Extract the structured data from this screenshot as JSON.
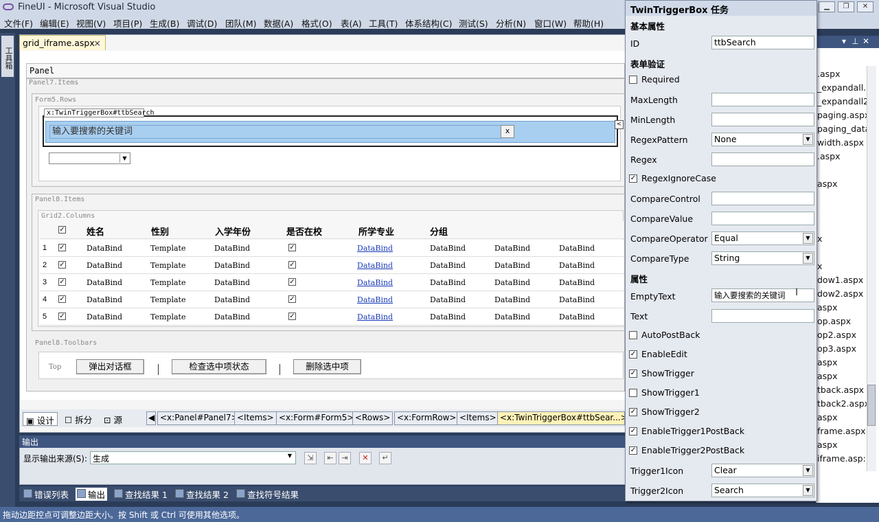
{
  "window": {
    "title": "FineUI - Microsoft Visual Studio"
  },
  "menu": [
    "文件(F)",
    "编辑(E)",
    "视图(V)",
    "项目(P)",
    "生成(B)",
    "调试(D)",
    "团队(M)",
    "数据(A)",
    "格式(O)",
    "表(A)",
    "工具(T)",
    "体系结构(C)",
    "测试(S)",
    "分析(N)",
    "窗口(W)",
    "帮助(H)"
  ],
  "toolbox_tab": "工具箱",
  "doc_tab": {
    "label": "grid_iframe.aspx",
    "close": "×"
  },
  "design": {
    "panel_title": "Panel",
    "panel7_items": "Panel7.Items",
    "form5_rows": "Form5.Rows",
    "ttb_tag": "x:TwinTriggerBox#ttbSearch",
    "ttb_empty_text": "输入要搜索的关键词",
    "ttb_clear": "x",
    "smart_tag": "<",
    "panel8_items": "Panel8.Items",
    "grid2_columns": "Grid2.Columns",
    "panel8_toolbars": "Panel8.Toolbars",
    "toolbar_pos": "Top",
    "buttons": [
      "弹出对话框",
      "检查选中项状态",
      "删除选中项"
    ]
  },
  "grid": {
    "headers": [
      "姓名",
      "性别",
      "入学年份",
      "是否在校",
      "所学专业",
      "分组"
    ],
    "rows": [
      {
        "n": "1",
        "c1": "DataBind",
        "c2": "Template",
        "c3": "DataBind",
        "c5": "DataBind",
        "c6": "DataBind",
        "c7": "DataBind",
        "c8": "DataBind"
      },
      {
        "n": "2",
        "c1": "DataBind",
        "c2": "Template",
        "c3": "DataBind",
        "c5": "DataBind",
        "c6": "DataBind",
        "c7": "DataBind",
        "c8": "DataBind"
      },
      {
        "n": "3",
        "c1": "DataBind",
        "c2": "Template",
        "c3": "DataBind",
        "c5": "DataBind",
        "c6": "DataBind",
        "c7": "DataBind",
        "c8": "DataBind"
      },
      {
        "n": "4",
        "c1": "DataBind",
        "c2": "Template",
        "c3": "DataBind",
        "c5": "DataBind",
        "c6": "DataBind",
        "c7": "DataBind",
        "c8": "DataBind"
      },
      {
        "n": "5",
        "c1": "DataBind",
        "c2": "Template",
        "c3": "DataBind",
        "c5": "DataBind",
        "c6": "DataBind",
        "c7": "DataBind",
        "c8": "DataBind"
      }
    ]
  },
  "view_tabs": {
    "design": "设计",
    "split": "拆分",
    "source": "源"
  },
  "breadcrumbs": [
    "<x:Panel#Panel7>",
    "<Items>",
    "<x:Form#Form5>",
    "<Rows>",
    "<x:FormRow>",
    "<Items>",
    "<x:TwinTriggerBox#ttbSear...>"
  ],
  "output": {
    "title": "输出",
    "source_label": "显示输出来源(S):",
    "source_value": "生成"
  },
  "bottom_tabs": [
    "错误列表",
    "输出",
    "查找结果 1",
    "查找结果 2",
    "查找符号结果"
  ],
  "status": "拖动边距控点可调整边距大小。按 Shift 或 Ctrl 可使用其他选项。",
  "solution_items": [
    ".aspx",
    "_expandall.a",
    "_expandall2",
    "paging.aspx",
    "paging_data",
    "width.aspx",
    ".aspx",
    "aspx",
    "x",
    "x",
    "dow1.aspx",
    "dow2.aspx",
    "aspx",
    "op.aspx",
    "op2.aspx",
    "op3.aspx",
    "aspx",
    "aspx",
    "tback.aspx",
    "tback2.aspx",
    "aspx",
    "frame.aspx",
    "aspx",
    "iframe.asp:"
  ],
  "tasks": {
    "title": "TwinTriggerBox 任务",
    "sec_basic": "基本属性",
    "id_label": "ID",
    "id_value": "ttbSearch",
    "sec_validation": "表单验证",
    "required": "Required",
    "maxlength": "MaxLength",
    "minlength": "MinLength",
    "regexpattern": "RegexPattern",
    "regexpattern_value": "None",
    "regex": "Regex",
    "regexignorecase": "RegexIgnoreCase",
    "comparecontrol": "CompareControl",
    "comparevalue": "CompareValue",
    "compareoperator": "CompareOperator",
    "compareoperator_value": "Equal",
    "comparetype": "CompareType",
    "comparetype_value": "String",
    "sec_props": "属性",
    "emptytext": "EmptyText",
    "emptytext_value": "输入要搜索的关键词",
    "text": "Text",
    "autopostback": "AutoPostBack",
    "enableedit": "EnableEdit",
    "showtrigger": "ShowTrigger",
    "showtrigger1": "ShowTrigger1",
    "showtrigger2": "ShowTrigger2",
    "enabletrigger1postback": "EnableTrigger1PostBack",
    "enabletrigger2postback": "EnableTrigger2PostBack",
    "trigger1icon": "Trigger1Icon",
    "trigger1icon_value": "Clear",
    "trigger2icon": "Trigger2Icon",
    "trigger2icon_value": "Search"
  },
  "check": "✓",
  "colors": {
    "accent": "#3e5680",
    "ttb_field": "#a8cef0",
    "link": "#1a3ab8"
  }
}
